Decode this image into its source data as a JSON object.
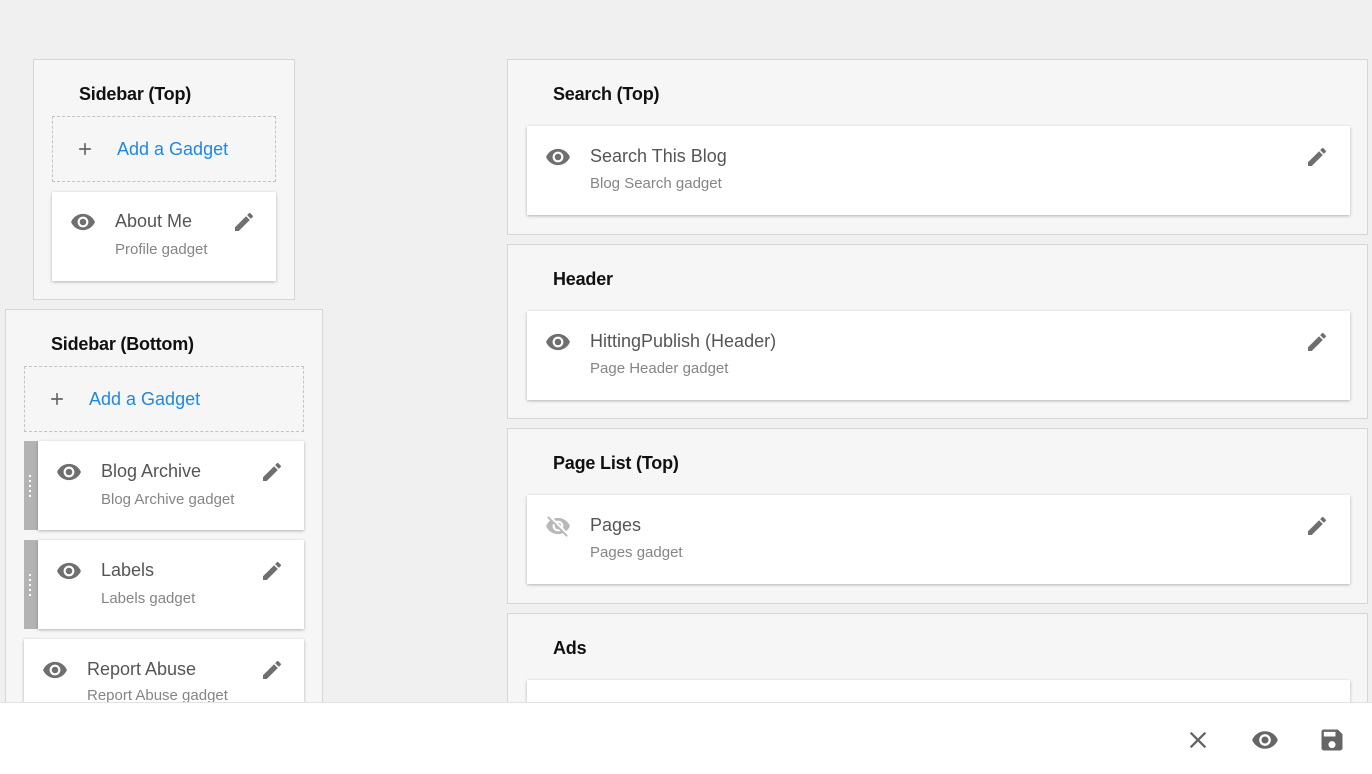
{
  "add_gadget_label": "Add a Gadget",
  "sidebar_top": {
    "title": "Sidebar (Top)",
    "gadgets": [
      {
        "title": "About Me",
        "subtitle": "Profile gadget",
        "visible": true
      }
    ]
  },
  "sidebar_bottom": {
    "title": "Sidebar (Bottom)",
    "gadgets": [
      {
        "title": "Blog Archive",
        "subtitle": "Blog Archive gadget",
        "visible": true
      },
      {
        "title": "Labels",
        "subtitle": "Labels gadget",
        "visible": true
      },
      {
        "title": "Report Abuse",
        "subtitle": "Report Abuse gadget",
        "visible": true
      }
    ]
  },
  "search_top": {
    "title": "Search (Top)",
    "gadgets": [
      {
        "title": "Search This Blog",
        "subtitle": "Blog Search gadget",
        "visible": true
      }
    ]
  },
  "header": {
    "title": "Header",
    "gadgets": [
      {
        "title": "HittingPublish (Header)",
        "subtitle": "Page Header gadget",
        "visible": true
      }
    ]
  },
  "page_list_top": {
    "title": "Page List (Top)",
    "gadgets": [
      {
        "title": "Pages",
        "subtitle": "Pages gadget",
        "visible": false
      }
    ]
  },
  "ads": {
    "title": "Ads"
  },
  "icons": {
    "visible": "eye-icon",
    "hidden": "eye-off-icon",
    "edit": "pencil-icon",
    "add": "plus-icon",
    "close": "close-icon",
    "preview": "eye-icon",
    "save": "save-icon"
  },
  "colors": {
    "accent": "#1e88e5",
    "icon": "#6f6f6f",
    "icon_disabled": "#b8b8b8"
  }
}
